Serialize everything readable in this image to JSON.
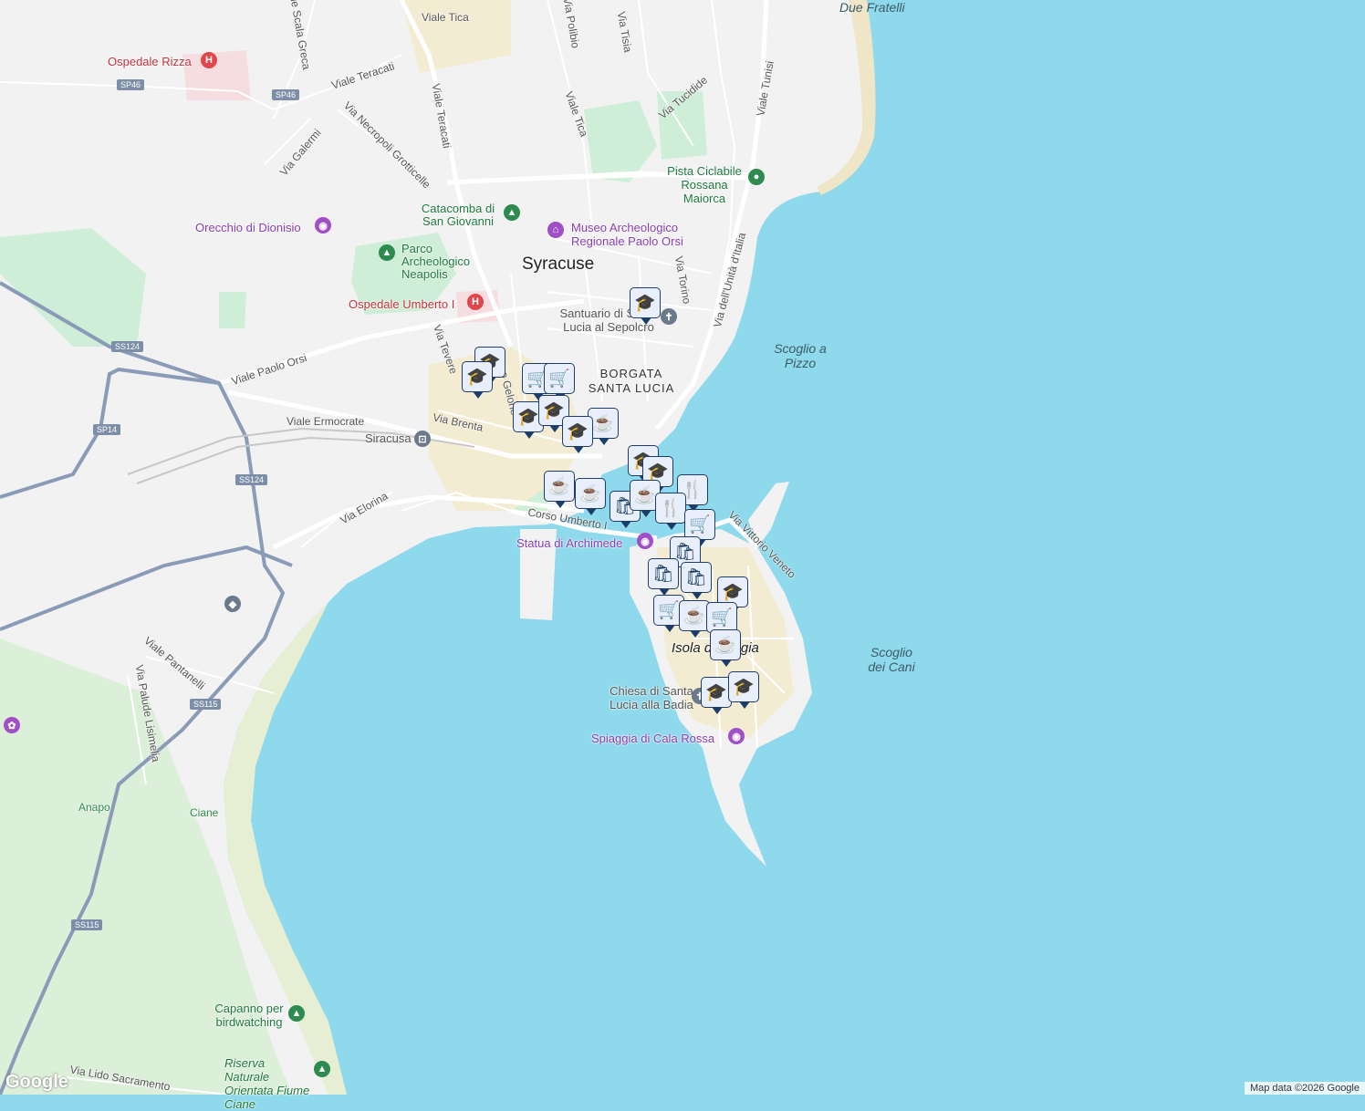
{
  "map": {
    "city": "Syracuse",
    "district": "BORGATA SANTA LUCIA",
    "island": "Isola di Ortigia",
    "sea_labels": [
      "Scoglio a Pizzo",
      "Scoglio dei Cani",
      "Due Fratelli"
    ],
    "road_labels": [
      "Viale Tica",
      "Via Polibio",
      "Via Tisia",
      "Viale Scala Greca",
      "Viale Teracati",
      "Viale Teracati",
      "Via Tucidide",
      "Viale Tica",
      "Viale Tunisi",
      "Via Necropoli Grotticelle",
      "Via Galermi",
      "Via Torino",
      "Via dell'Unità d'Italia",
      "Viale Paolo Orsi",
      "Via Tevere",
      "Via Brenta",
      "Viale Ermocrate",
      "Via Elorina",
      "Corso Umberto I",
      "Via Vittorio Veneto",
      "Viale Pantanelli",
      "Via Palude Lisimelia",
      "Via Lido Sacramento",
      "Anapo",
      "Ciane",
      "Corso Gelone"
    ],
    "road_shields": [
      "SP46",
      "SP46",
      "SS124",
      "SP14",
      "SS124",
      "SS115",
      "SS115"
    ],
    "pois": [
      {
        "name": "Ospedale Rizza",
        "kind": "hospital"
      },
      {
        "name": "Ospedale Umberto I",
        "kind": "hospital"
      },
      {
        "name": "Orecchio di Dionisio",
        "kind": "attraction"
      },
      {
        "name": "Catacomba di San Giovanni",
        "kind": "park"
      },
      {
        "name": "Parco Archeologico Neapolis",
        "kind": "park"
      },
      {
        "name": "Museo Archeologico Regionale Paolo Orsi",
        "kind": "attraction"
      },
      {
        "name": "Santuario di Santa Lucia al Sepolcro",
        "kind": "church"
      },
      {
        "name": "Pista Ciclabile Rossana Maiorca",
        "kind": "park"
      },
      {
        "name": "Siracusa",
        "kind": "station"
      },
      {
        "name": "Statua di Archimede",
        "kind": "attraction"
      },
      {
        "name": "Chiesa di Santa Lucia alla Badia",
        "kind": "church"
      },
      {
        "name": "Spiaggia di Cala Rossa",
        "kind": "attraction"
      },
      {
        "name": "Capanno per birdwatching",
        "kind": "park"
      },
      {
        "name": "Riserva Naturale Orientata Fiume Ciane",
        "kind": "park"
      }
    ],
    "markers": [
      {
        "icon": "school-icon",
        "glyph": "🎓"
      },
      {
        "icon": "school-icon",
        "glyph": "🎓"
      },
      {
        "icon": "school-icon",
        "glyph": "🎓"
      },
      {
        "icon": "cart-icon",
        "glyph": "🛒"
      },
      {
        "icon": "cart-icon",
        "glyph": "🛒"
      },
      {
        "icon": "school-icon",
        "glyph": "🎓"
      },
      {
        "icon": "school-icon",
        "glyph": "🎓"
      },
      {
        "icon": "cafe-icon",
        "glyph": "☕"
      },
      {
        "icon": "school-icon",
        "glyph": "🎓"
      },
      {
        "icon": "school-icon",
        "glyph": "🎓"
      },
      {
        "icon": "school-icon",
        "glyph": "🎓"
      },
      {
        "icon": "cafe-icon",
        "glyph": "☕"
      },
      {
        "icon": "cafe-icon",
        "glyph": "☕"
      },
      {
        "icon": "bag-icon",
        "glyph": "🛍"
      },
      {
        "icon": "cafe-icon",
        "glyph": "☕"
      },
      {
        "icon": "restaurant-icon",
        "glyph": "🍴"
      },
      {
        "icon": "restaurant-icon",
        "glyph": "🍴"
      },
      {
        "icon": "cart-icon",
        "glyph": "🛒"
      },
      {
        "icon": "bag-icon",
        "glyph": "🛍"
      },
      {
        "icon": "bag-icon",
        "glyph": "🛍"
      },
      {
        "icon": "bag-icon",
        "glyph": "🛍"
      },
      {
        "icon": "school-icon",
        "glyph": "🎓"
      },
      {
        "icon": "cart-icon",
        "glyph": "🛒"
      },
      {
        "icon": "cafe-icon",
        "glyph": "☕"
      },
      {
        "icon": "cart-icon",
        "glyph": "🛒"
      },
      {
        "icon": "cafe-icon",
        "glyph": "☕"
      },
      {
        "icon": "school-icon",
        "glyph": "🎓"
      },
      {
        "icon": "school-icon",
        "glyph": "🎓"
      }
    ],
    "colors": {
      "sea": "#8fd9ec",
      "land": "#f2f2f2",
      "park": "#c9ecd2",
      "road": "#ffffff",
      "highway": "#8a9bb8",
      "town": "#f4ecd2"
    }
  },
  "footer": {
    "logo": "Google",
    "credits": "Map data ©2026 Google"
  }
}
